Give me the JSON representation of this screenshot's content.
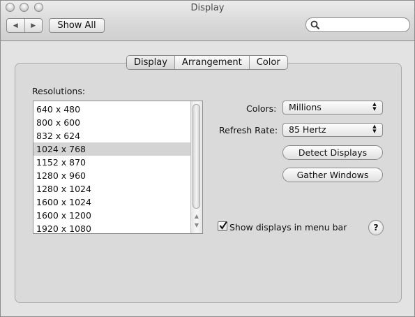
{
  "window": {
    "title": "Display"
  },
  "toolbar": {
    "back_icon": "◀",
    "forward_icon": "▶",
    "show_all_label": "Show All",
    "search_value": ""
  },
  "tabs": [
    {
      "label": "Display",
      "selected": true
    },
    {
      "label": "Arrangement",
      "selected": false
    },
    {
      "label": "Color",
      "selected": false
    }
  ],
  "resolutions": {
    "label": "Resolutions:",
    "items": [
      "640 x 480",
      "800 x 600",
      "832 x 624",
      "1024 x 768",
      "1152 x 870",
      "1280 x 960",
      "1280 x 1024",
      "1600 x 1024",
      "1600 x 1200",
      "1920 x 1080"
    ],
    "selected": "1024 x 768"
  },
  "colors": {
    "label": "Colors:",
    "value": "Millions"
  },
  "refresh_rate": {
    "label": "Refresh Rate:",
    "value": "85 Hertz"
  },
  "buttons": {
    "detect_displays": "Detect Displays",
    "gather_windows": "Gather Windows"
  },
  "menu_bar_checkbox": {
    "label": "Show displays in menu bar",
    "checked": true
  },
  "help_label": "?"
}
